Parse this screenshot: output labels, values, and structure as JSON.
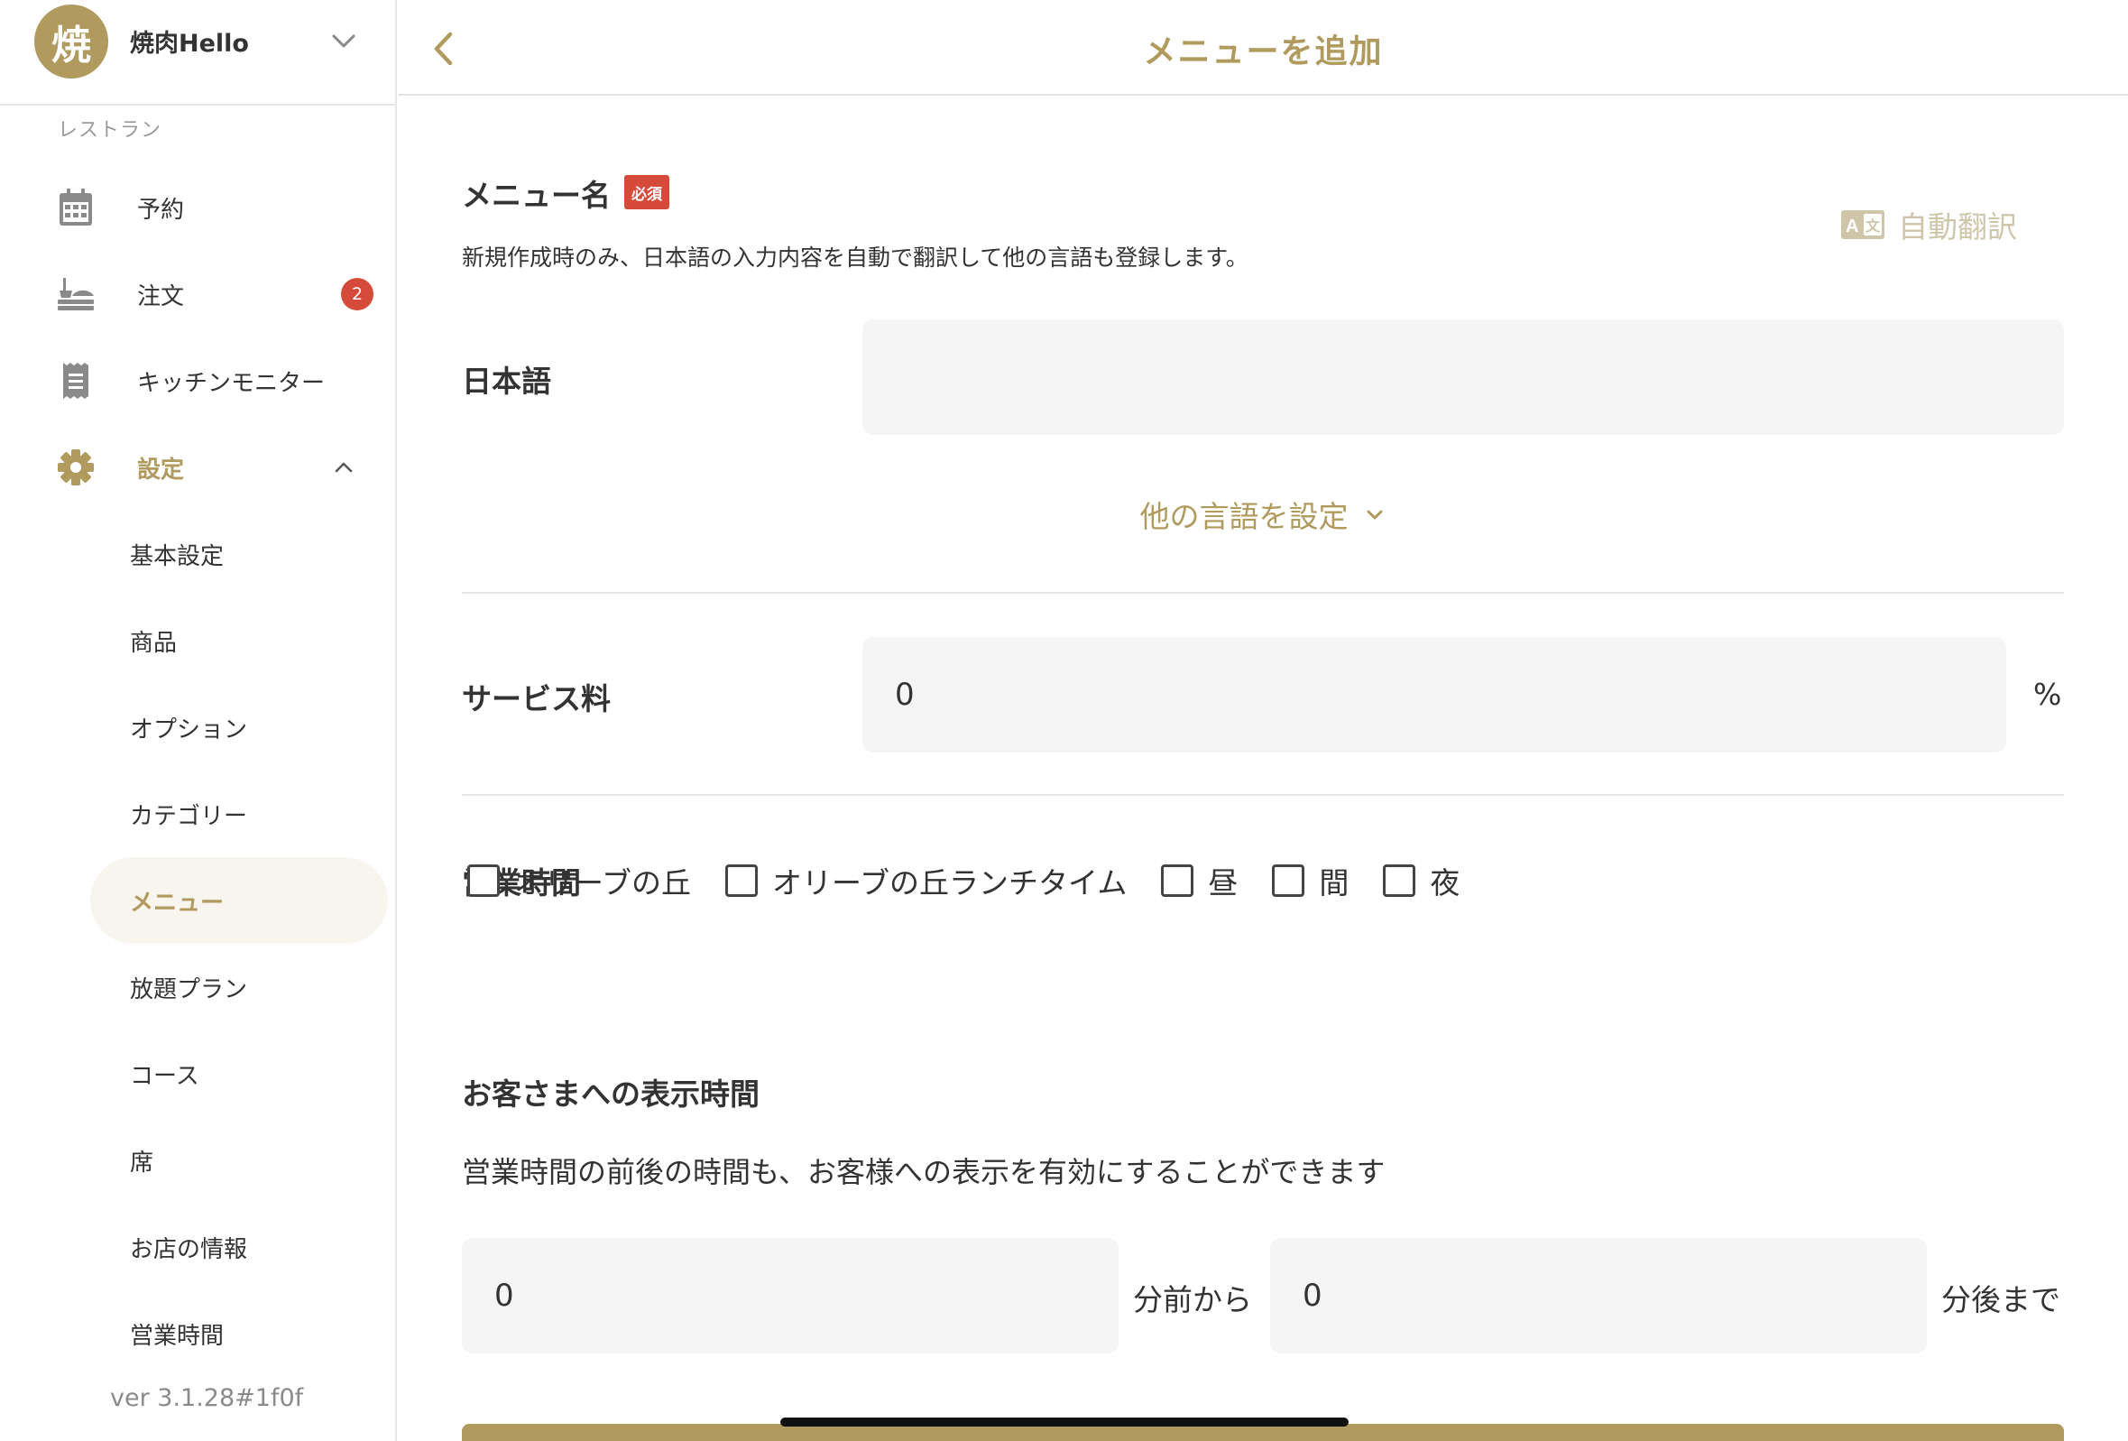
{
  "sidebar": {
    "store": {
      "avatar_char": "焼",
      "name": "焼肉Hello"
    },
    "section_label": "レストラン",
    "items": [
      {
        "label": "予約",
        "icon": "calendar-icon"
      },
      {
        "label": "注文",
        "icon": "order-icon",
        "badge": "2"
      },
      {
        "label": "キッチンモニター",
        "icon": "receipt-icon"
      },
      {
        "label": "設定",
        "icon": "gear-icon"
      }
    ],
    "sub_items": [
      "基本設定",
      "商品",
      "オプション",
      "カテゴリー",
      "メニュー",
      "放題プラン",
      "コース",
      "席",
      "お店の情報",
      "営業時間"
    ],
    "version": "ver 3.1.28#1f0f"
  },
  "header": {
    "title": "メニューを追加"
  },
  "form": {
    "menu_name": {
      "title": "メニュー名",
      "required_badge": "必須",
      "auto_translate_label": "自動翻訳",
      "helper": "新規作成時のみ、日本語の入力内容を自動で翻訳して他の言語も登録します。",
      "japanese_label": "日本語",
      "japanese_value": "",
      "other_languages_label": "他の言語を設定"
    },
    "service_fee": {
      "title": "サービス料",
      "value": "0",
      "unit": "%"
    },
    "business_hours": {
      "title": "営業時間",
      "options": [
        "オリーブの丘",
        "オリーブの丘ランチタイム",
        "昼",
        "間",
        "夜"
      ]
    },
    "display_time": {
      "title": "お客さまへの表示時間",
      "helper": "営業時間の前後の時間も、お客様への表示を有効にすることができます",
      "before_value": "0",
      "before_unit": "分前から",
      "after_value": "0",
      "after_unit": "分後まで"
    }
  },
  "colors": {
    "accent": "#b09a5e",
    "badge_red": "#d64a3a",
    "input_bg": "#f5f5f5",
    "selected_bg": "#f7f5ee",
    "translate_disabled": "#cfc6aa"
  }
}
